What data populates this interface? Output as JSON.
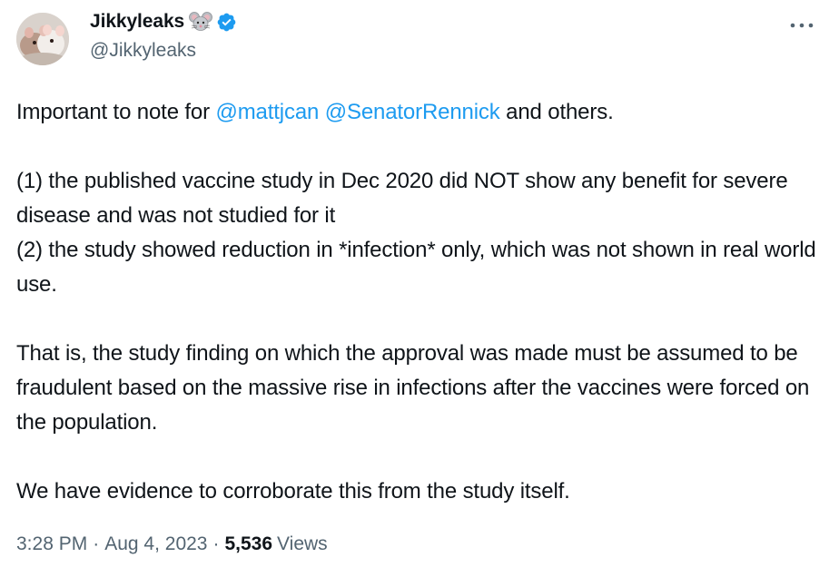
{
  "author": {
    "display_name": "Jikkyleaks",
    "handle": "@Jikkyleaks",
    "name_emoji": "mouse-face-icon",
    "verified_color": "#1d9bf0"
  },
  "tweet": {
    "intro": {
      "lead": "Important to note for ",
      "mention_1": "@mattjcan",
      "space": " ",
      "mention_2": "@SenatorRennick",
      "tail": " and others."
    },
    "point_1": "(1) the published vaccine study in Dec 2020 did NOT show any benefit for severe disease and was not studied for it",
    "point_2": "(2) the study showed reduction in *infection* only, which was not shown in real world use.",
    "paragraph_3": "That is, the study finding on which the approval was made must be assumed to be fraudulent based on the massive rise in infections after the vaccines were forced on the population.",
    "paragraph_4": "We have evidence to corroborate this from the study itself."
  },
  "meta": {
    "time": "3:28 PM",
    "separator": "·",
    "date": "Aug 4, 2023",
    "views_count": "5,536",
    "views_label": "Views"
  },
  "colors": {
    "link": "#1d9bf0",
    "text": "#0f1419",
    "secondary": "#536471"
  }
}
